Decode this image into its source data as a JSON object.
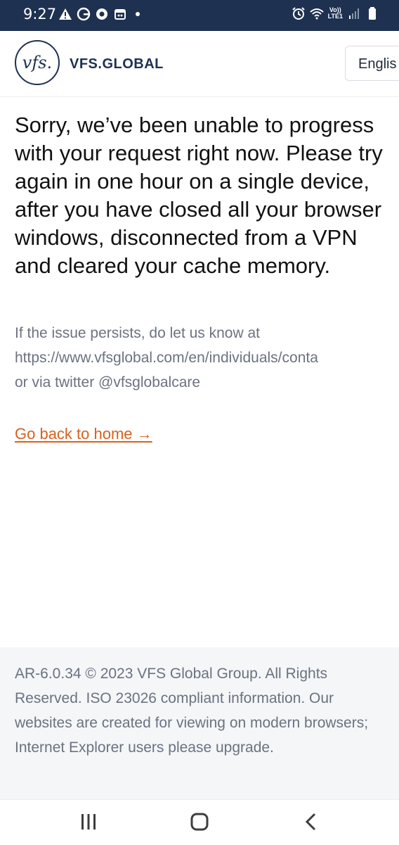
{
  "status_bar": {
    "time": "9:27",
    "left_icons": [
      "warning-icon",
      "google-icon",
      "record-icon",
      "calendar-icon",
      "notification-dot-icon"
    ],
    "right_icons": [
      "alarm-icon",
      "wifi-icon",
      "volte-icon",
      "signal-icon",
      "battery-icon"
    ],
    "network_label_top": "Vo))",
    "network_label_bottom": "LTE1"
  },
  "header": {
    "logo_mark": "vfs.",
    "logo_text": "VFS.GLOBAL",
    "language_button": "Englis"
  },
  "main": {
    "headline": "Sorry, we’ve been unable to progress with your request right now. Please try again in one hour on a single device, after you have closed all your browser windows, disconnected from a VPN and cleared your cache memory.",
    "info_line_1": "If the issue persists, do let us know at",
    "info_line_2": "https://www.vfsglobal.com/en/individuals/conta",
    "info_line_3": "or via twitter @vfsglobalcare",
    "home_link": "Go back to home →"
  },
  "footer": {
    "text": "AR-6.0.34 © 2023 VFS Global Group. All Rights Reserved. ISO 23026 compliant information. Our websites are created for viewing on modern browsers; Internet Explorer users please upgrade."
  },
  "colors": {
    "status_bar_bg": "#1f3150",
    "brand_navy": "#1f3150",
    "link_orange": "#d9601f",
    "muted_text": "#6b7280",
    "footer_bg": "#f4f6f8"
  }
}
